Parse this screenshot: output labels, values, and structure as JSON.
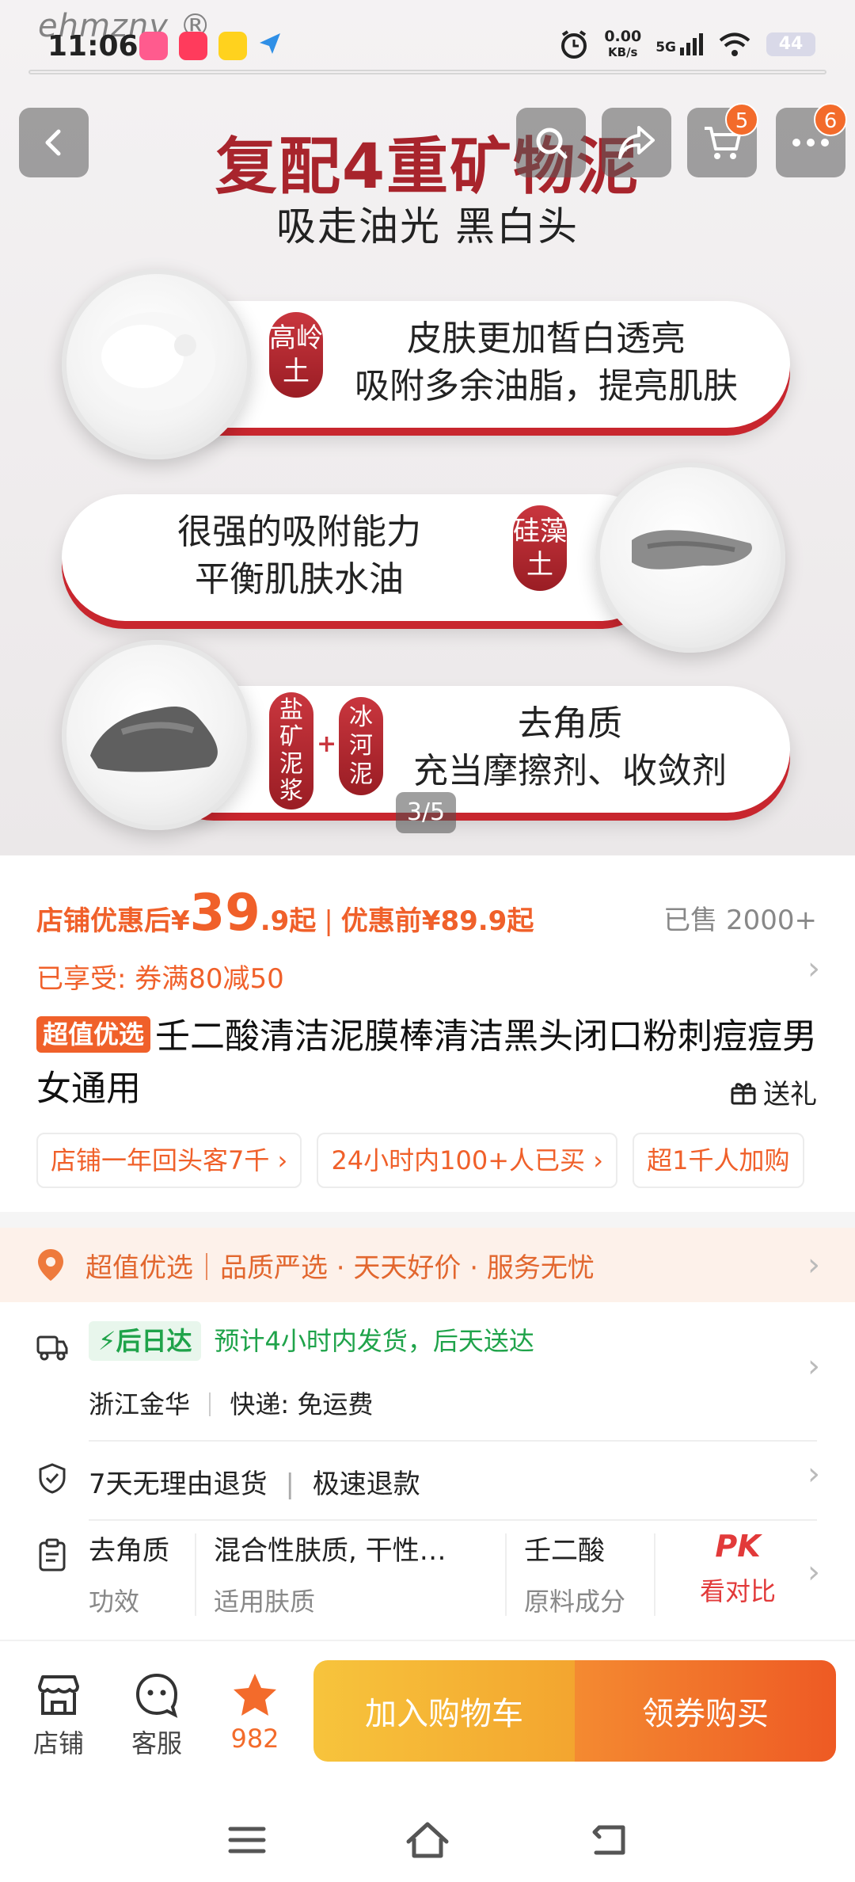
{
  "status": {
    "watermark": "ehmzny ®",
    "time": "11:06",
    "speed_value": "0.00",
    "speed_unit": "KB/s",
    "network": "5G",
    "battery": "44"
  },
  "hero": {
    "title": "复配4重矿物泥",
    "subtitle": "吸走油光 黑白头",
    "item1": {
      "tag": "高岭土",
      "line1": "皮肤更加皙白透亮",
      "line2": "吸附多余油脂，提亮肌肤"
    },
    "item2": {
      "tag": "硅藻土",
      "line1": "很强的吸附能力",
      "line2": "平衡肌肤水油"
    },
    "item3": {
      "tag_a": "盐矿泥浆",
      "tag_b": "冰河泥",
      "plus": "+",
      "line1": "去角质",
      "line2": "充当摩擦剂、收敛剂"
    },
    "pager": "3/5",
    "cart_badge": "5",
    "more_badge": "6"
  },
  "price": {
    "label": "店铺优惠后",
    "currency": "¥",
    "main": "39",
    "decimal": ".9起",
    "sep": "|",
    "before": "优惠前¥89.9起",
    "sold": "已售 2000+"
  },
  "coupon": "已享受: 券满80减50",
  "product": {
    "badge": "超值优选",
    "title": "壬二酸清洁泥膜棒清洁黑头闭口粉刺痘痘男女通用",
    "gift": "送礼"
  },
  "chips": [
    "店铺一年回头客7千",
    "24小时内100+人已买",
    "超1千人加购"
  ],
  "guarantee": {
    "text": "超值优选｜品质严选 · 天天好价 · 服务无忧"
  },
  "shipping": {
    "badge": "后日达",
    "text": "预计4小时内发货，后天送达",
    "origin": "浙江金华",
    "express": "快递: 免运费"
  },
  "returns": {
    "text": "7天无理由退货",
    "sep": "|",
    "refund": "极速退款"
  },
  "attrs": [
    {
      "top": "去角质",
      "bottom": "功效"
    },
    {
      "top": "混合性肤质, 干性…",
      "bottom": "适用肤质"
    },
    {
      "top": "壬二酸",
      "bottom": "原料成分"
    }
  ],
  "compare": {
    "pk": "PK",
    "label": "看对比"
  },
  "bottom": {
    "shop": "店铺",
    "service": "客服",
    "fav": "982",
    "add_cart": "加入购物车",
    "buy": "领券购买"
  },
  "colors": {
    "accent": "#f0602a",
    "hero_red": "#a8242c",
    "green": "#1fa34a"
  }
}
